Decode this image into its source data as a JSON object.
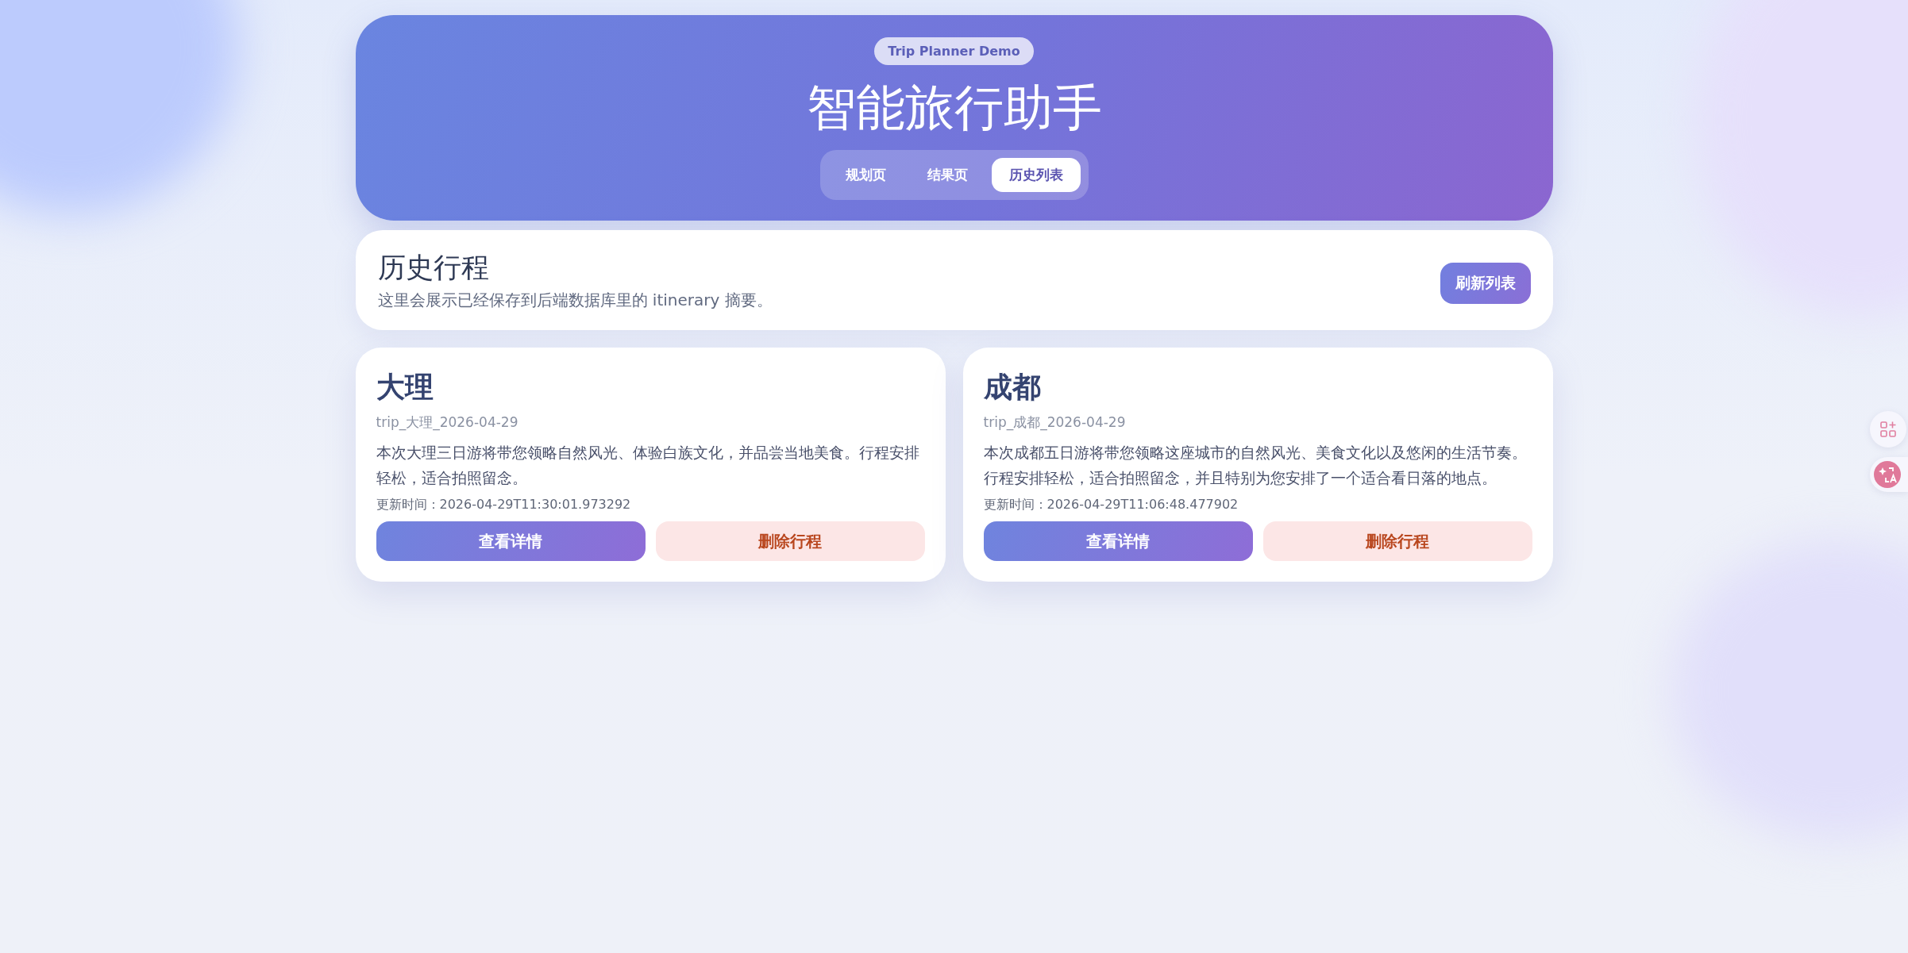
{
  "header": {
    "badge": "Trip Planner Demo",
    "title": "智能旅行助手",
    "tabs": [
      {
        "label": "规划页",
        "selected": false
      },
      {
        "label": "结果页",
        "selected": false
      },
      {
        "label": "历史列表",
        "selected": true
      }
    ]
  },
  "history_panel": {
    "title": "历史行程",
    "description": "这里会展示已经保存到后端数据库里的 itinerary 摘要。",
    "refresh_button": "刷新列表"
  },
  "trips": [
    {
      "name": "大理",
      "id": "trip_大理_2026-04-29",
      "summary": "本次大理三日游将带您领略自然风光、体验白族文化，并品尝当地美食。行程安排轻松，适合拍照留念。",
      "updated": "更新时间：2026-04-29T11:30:01.973292",
      "view_button": "查看详情",
      "delete_button": "删除行程"
    },
    {
      "name": "成都",
      "id": "trip_成都_2026-04-29",
      "summary": "本次成都五日游将带您领略这座城市的自然风光、美食文化以及悠闲的生活节奏。行程安排轻松，适合拍照留念，并且特别为您安排了一个适合看日落的地点。",
      "updated": "更新时间：2026-04-29T11:06:48.477902",
      "view_button": "查看详情",
      "delete_button": "删除行程"
    }
  ]
}
